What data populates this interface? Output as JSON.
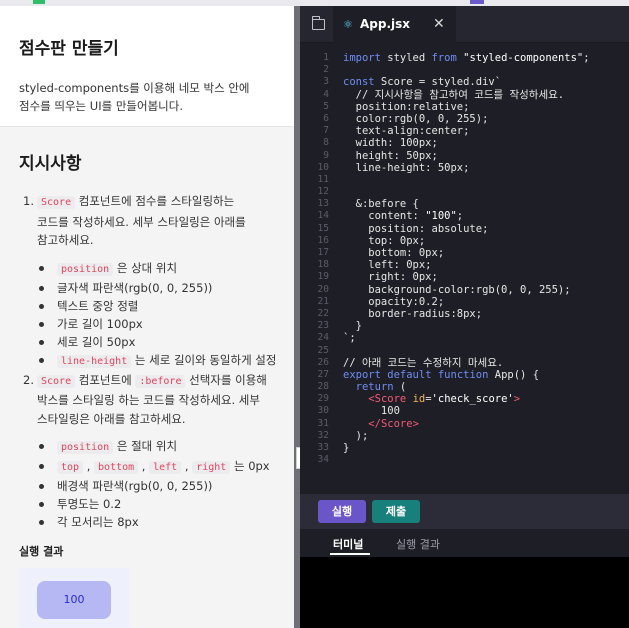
{
  "lesson": {
    "title": "점수판 만들기",
    "desc_line1": "styled-components를 이용해 네모 박스 안에",
    "desc_line2": "점수를 띄우는 UI를 만들어봅니다."
  },
  "instructions": {
    "heading": "지시사항",
    "step1": {
      "num": "1.",
      "code": "Score",
      "text1": " 컴포넌트에 점수를 스타일링하는",
      "text2": "코드를 작성하세요. 세부 스타일링은 아래를",
      "text3": "참고하세요.",
      "bullets": [
        {
          "code": "position",
          "text": " 은 상대 위치"
        },
        {
          "code": "",
          "text": "글자색 파란색(rgb(0, 0, 255))"
        },
        {
          "code": "",
          "text": "텍스트 중앙 정렬"
        },
        {
          "code": "",
          "text": "가로 길이 100px"
        },
        {
          "code": "",
          "text": "세로 길이 50px"
        },
        {
          "code": "line-height",
          "text": " 는 세로 길이와 동일하게 설정"
        }
      ]
    },
    "step2": {
      "num": "2.",
      "code1": "Score",
      "text1a": " 컴포넌트에 ",
      "code2": ":before",
      "text1b": " 선택자를 이용해",
      "text2": "박스를 스타일링 하는 코드를 작성하세요. 세부",
      "text3": "스타일링은 아래를 참고하세요.",
      "bullet1": {
        "code": "position",
        "text": " 은 절대 위치"
      },
      "bullet2": {
        "c1": "top",
        "c2": "bottom",
        "c3": "left",
        "c4": "right",
        "sep": " , ",
        "text": " 는 0px"
      },
      "bullet3": "배경색 파란색(rgb(0, 0, 255))",
      "bullet4": "투명도는 0.2",
      "bullet5": "각 모서리는 8px"
    }
  },
  "result": {
    "label": "실행 결과",
    "score": "100"
  },
  "editor": {
    "tab_name": "App.jsx",
    "icons": {
      "explorer": "file-folder-icon",
      "react": "react-icon",
      "close": "close-icon",
      "collapse": "chevron-left-icon"
    },
    "collapse_glyph": "«",
    "lines": [
      {
        "n": "1",
        "t": "import styled from \"styled-components\";"
      },
      {
        "n": "2",
        "t": ""
      },
      {
        "n": "3",
        "t": "const Score = styled.div`"
      },
      {
        "n": "4",
        "t": "  // 지시사항을 참고하여 코드를 작성하세요."
      },
      {
        "n": "5",
        "t": "  position:relative;"
      },
      {
        "n": "6",
        "t": "  color:rgb(0, 0, 255);"
      },
      {
        "n": "7",
        "t": "  text-align:center;"
      },
      {
        "n": "8",
        "t": "  width: 100px;"
      },
      {
        "n": "9",
        "t": "  height: 50px;"
      },
      {
        "n": "10",
        "t": "  line-height: 50px;"
      },
      {
        "n": "11",
        "t": ""
      },
      {
        "n": "12",
        "t": "  "
      },
      {
        "n": "13",
        "t": "  &:before {"
      },
      {
        "n": "14",
        "t": "    content: \"100\";"
      },
      {
        "n": "15",
        "t": "    position: absolute;"
      },
      {
        "n": "16",
        "t": "    top: 0px;"
      },
      {
        "n": "17",
        "t": "    bottom: 0px;"
      },
      {
        "n": "18",
        "t": "    left: 0px;"
      },
      {
        "n": "19",
        "t": "    right: 0px;"
      },
      {
        "n": "20",
        "t": "    background-color:rgb(0, 0, 255);"
      },
      {
        "n": "21",
        "t": "    opacity:0.2;"
      },
      {
        "n": "22",
        "t": "    border-radius:8px;"
      },
      {
        "n": "23",
        "t": "  }"
      },
      {
        "n": "24",
        "t": "`;"
      },
      {
        "n": "25",
        "t": ""
      },
      {
        "n": "26",
        "t": "// 아래 코드는 수정하지 마세요."
      },
      {
        "n": "27",
        "t": "export default function App() {"
      },
      {
        "n": "28",
        "t": "  return ("
      },
      {
        "n": "29",
        "t": "    <Score id='check_score'>"
      },
      {
        "n": "30",
        "t": "      100"
      },
      {
        "n": "31",
        "t": "    </Score>"
      },
      {
        "n": "32",
        "t": "  );"
      },
      {
        "n": "33",
        "t": "}"
      },
      {
        "n": "34",
        "t": ""
      }
    ]
  },
  "actions": {
    "run": "실행",
    "submit": "제출"
  },
  "panel": {
    "terminal": "터미널",
    "output": "실행 결과"
  }
}
